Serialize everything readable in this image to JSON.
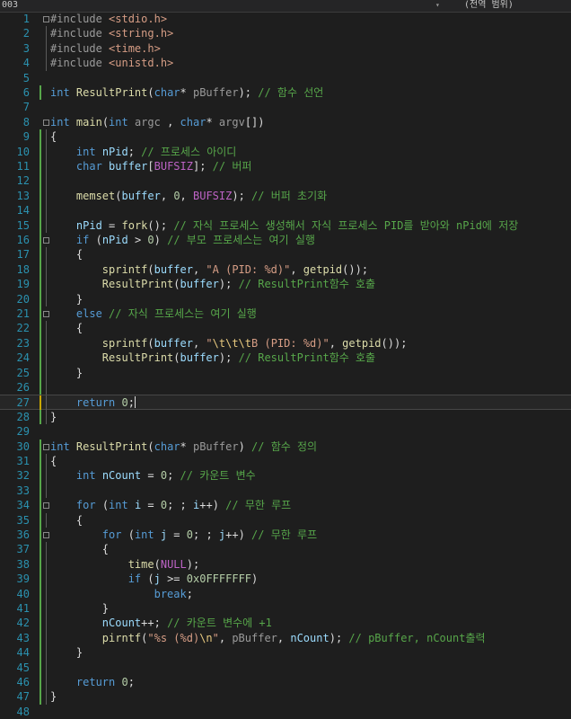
{
  "header": {
    "file_label": "003",
    "scope_label": "(전역 범위)"
  },
  "lines": [
    {
      "n": "1",
      "fold": "box",
      "guide": "",
      "tokens": [
        [
          "pp",
          "#include "
        ],
        [
          "st",
          "<stdio.h>"
        ]
      ]
    },
    {
      "n": "2",
      "fold": "v",
      "guide": "",
      "tokens": [
        [
          "pp",
          "#include "
        ],
        [
          "st",
          "<string.h>"
        ]
      ]
    },
    {
      "n": "3",
      "fold": "v",
      "guide": "",
      "tokens": [
        [
          "pp",
          "#include "
        ],
        [
          "st",
          "<time.h>"
        ]
      ]
    },
    {
      "n": "4",
      "fold": "v",
      "guide": "",
      "tokens": [
        [
          "pp",
          "#include "
        ],
        [
          "st",
          "<unistd.h>"
        ]
      ]
    },
    {
      "n": "5",
      "fold": "",
      "guide": "",
      "tokens": []
    },
    {
      "n": "6",
      "fold": "",
      "guide": "green",
      "tokens": [
        [
          "kw",
          "int "
        ],
        [
          "fn",
          "ResultPrint"
        ],
        [
          "",
          "("
        ],
        [
          "kw",
          "char"
        ],
        [
          "",
          "* "
        ],
        [
          "par",
          "pBuffer"
        ],
        [
          "",
          "); "
        ],
        [
          "cm",
          "// 함수 선언"
        ]
      ]
    },
    {
      "n": "7",
      "fold": "",
      "guide": "",
      "tokens": []
    },
    {
      "n": "8",
      "fold": "box",
      "guide": "",
      "tokens": [
        [
          "kw",
          "int "
        ],
        [
          "fn",
          "main"
        ],
        [
          "",
          "("
        ],
        [
          "kw",
          "int "
        ],
        [
          "par",
          "argc"
        ],
        [
          "",
          " , "
        ],
        [
          "kw",
          "char"
        ],
        [
          "",
          "* "
        ],
        [
          "par",
          "argv"
        ],
        [
          "",
          "[])"
        ]
      ]
    },
    {
      "n": "9",
      "fold": "v",
      "guide": "green",
      "tokens": [
        [
          "",
          "{"
        ]
      ]
    },
    {
      "n": "10",
      "fold": "v",
      "guide": "green",
      "tokens": [
        [
          "",
          "    "
        ],
        [
          "kw",
          "int "
        ],
        [
          "va",
          "nPid"
        ],
        [
          "",
          "; "
        ],
        [
          "cm",
          "// 프로세스 아이디"
        ]
      ]
    },
    {
      "n": "11",
      "fold": "v",
      "guide": "green",
      "tokens": [
        [
          "",
          "    "
        ],
        [
          "kw",
          "char "
        ],
        [
          "va",
          "buffer"
        ],
        [
          "",
          "["
        ],
        [
          "mac",
          "BUFSIZ"
        ],
        [
          "",
          "]; "
        ],
        [
          "cm",
          "// 버퍼"
        ]
      ]
    },
    {
      "n": "12",
      "fold": "v",
      "guide": "green",
      "tokens": []
    },
    {
      "n": "13",
      "fold": "v",
      "guide": "green",
      "tokens": [
        [
          "",
          "    "
        ],
        [
          "fn",
          "memset"
        ],
        [
          "",
          "("
        ],
        [
          "va",
          "buffer"
        ],
        [
          "",
          ", "
        ],
        [
          "nu",
          "0"
        ],
        [
          "",
          ", "
        ],
        [
          "mac",
          "BUFSIZ"
        ],
        [
          "",
          "); "
        ],
        [
          "cm",
          "// 버퍼 초기화"
        ]
      ]
    },
    {
      "n": "14",
      "fold": "v",
      "guide": "green",
      "tokens": []
    },
    {
      "n": "15",
      "fold": "v",
      "guide": "green",
      "tokens": [
        [
          "",
          "    "
        ],
        [
          "va",
          "nPid"
        ],
        [
          "",
          " = "
        ],
        [
          "fn",
          "fork"
        ],
        [
          "",
          "(); "
        ],
        [
          "cm",
          "// 자식 프로세스 생성해서 자식 프로세스 PID를 받아와 nPid에 저장"
        ]
      ]
    },
    {
      "n": "16",
      "fold": "box",
      "guide": "green",
      "tokens": [
        [
          "",
          "    "
        ],
        [
          "kw",
          "if "
        ],
        [
          "",
          "("
        ],
        [
          "va",
          "nPid"
        ],
        [
          "",
          " > "
        ],
        [
          "nu",
          "0"
        ],
        [
          "",
          ") "
        ],
        [
          "cm",
          "// 부모 프로세스는 여기 실행"
        ]
      ]
    },
    {
      "n": "17",
      "fold": "v",
      "guide": "green",
      "tokens": [
        [
          "",
          "    {"
        ]
      ]
    },
    {
      "n": "18",
      "fold": "v",
      "guide": "green",
      "tokens": [
        [
          "",
          "        "
        ],
        [
          "fn",
          "sprintf"
        ],
        [
          "",
          "("
        ],
        [
          "va",
          "buffer"
        ],
        [
          "",
          ", "
        ],
        [
          "st",
          "\"A (PID: %d)\""
        ],
        [
          "",
          ", "
        ],
        [
          "fn",
          "getpid"
        ],
        [
          "",
          "());"
        ]
      ]
    },
    {
      "n": "19",
      "fold": "v",
      "guide": "green",
      "tokens": [
        [
          "",
          "        "
        ],
        [
          "fn",
          "ResultPrint"
        ],
        [
          "",
          "("
        ],
        [
          "va",
          "buffer"
        ],
        [
          "",
          "); "
        ],
        [
          "cm",
          "// ResultPrint함수 호출"
        ]
      ]
    },
    {
      "n": "20",
      "fold": "v",
      "guide": "green",
      "tokens": [
        [
          "",
          "    }"
        ]
      ]
    },
    {
      "n": "21",
      "fold": "box",
      "guide": "green",
      "tokens": [
        [
          "",
          "    "
        ],
        [
          "kw",
          "else "
        ],
        [
          "cm",
          "// 자식 프로세스는 여기 실행"
        ]
      ]
    },
    {
      "n": "22",
      "fold": "v",
      "guide": "green",
      "tokens": [
        [
          "",
          "    {"
        ]
      ]
    },
    {
      "n": "23",
      "fold": "v",
      "guide": "green",
      "tokens": [
        [
          "",
          "        "
        ],
        [
          "fn",
          "sprintf"
        ],
        [
          "",
          "("
        ],
        [
          "va",
          "buffer"
        ],
        [
          "",
          ", "
        ],
        [
          "st",
          "\""
        ],
        [
          "esc",
          "\\t\\t\\t"
        ],
        [
          "st",
          "B (PID: %d)\""
        ],
        [
          "",
          ", "
        ],
        [
          "fn",
          "getpid"
        ],
        [
          "",
          "());"
        ]
      ]
    },
    {
      "n": "24",
      "fold": "v",
      "guide": "green",
      "tokens": [
        [
          "",
          "        "
        ],
        [
          "fn",
          "ResultPrint"
        ],
        [
          "",
          "("
        ],
        [
          "va",
          "buffer"
        ],
        [
          "",
          "); "
        ],
        [
          "cm",
          "// ResultPrint함수 호출"
        ]
      ]
    },
    {
      "n": "25",
      "fold": "v",
      "guide": "green",
      "tokens": [
        [
          "",
          "    }"
        ]
      ]
    },
    {
      "n": "26",
      "fold": "v",
      "guide": "green",
      "tokens": []
    },
    {
      "n": "27",
      "fold": "v",
      "guide": "yellow",
      "cursor": true,
      "tokens": [
        [
          "",
          "    "
        ],
        [
          "kw",
          "return "
        ],
        [
          "nu",
          "0"
        ],
        [
          "",
          ";"
        ]
      ]
    },
    {
      "n": "28",
      "fold": "v",
      "guide": "green",
      "tokens": [
        [
          "",
          "}"
        ]
      ]
    },
    {
      "n": "29",
      "fold": "",
      "guide": "",
      "tokens": []
    },
    {
      "n": "30",
      "fold": "box",
      "guide": "green",
      "tokens": [
        [
          "kw",
          "int "
        ],
        [
          "fn",
          "ResultPrint"
        ],
        [
          "",
          "("
        ],
        [
          "kw",
          "char"
        ],
        [
          "",
          "* "
        ],
        [
          "par",
          "pBuffer"
        ],
        [
          "",
          ") "
        ],
        [
          "cm",
          "// 함수 정의"
        ]
      ]
    },
    {
      "n": "31",
      "fold": "v",
      "guide": "green",
      "tokens": [
        [
          "",
          "{"
        ]
      ]
    },
    {
      "n": "32",
      "fold": "v",
      "guide": "green",
      "tokens": [
        [
          "",
          "    "
        ],
        [
          "kw",
          "int "
        ],
        [
          "va",
          "nCount"
        ],
        [
          "",
          " = "
        ],
        [
          "nu",
          "0"
        ],
        [
          "",
          "; "
        ],
        [
          "cm",
          "// 카운트 변수"
        ]
      ]
    },
    {
      "n": "33",
      "fold": "v",
      "guide": "green",
      "tokens": []
    },
    {
      "n": "34",
      "fold": "box",
      "guide": "green",
      "tokens": [
        [
          "",
          "    "
        ],
        [
          "kw",
          "for "
        ],
        [
          "",
          "("
        ],
        [
          "kw",
          "int "
        ],
        [
          "va",
          "i"
        ],
        [
          "",
          " = "
        ],
        [
          "nu",
          "0"
        ],
        [
          "",
          "; ; "
        ],
        [
          "va",
          "i"
        ],
        [
          "",
          "++) "
        ],
        [
          "cm",
          "// 무한 루프"
        ]
      ]
    },
    {
      "n": "35",
      "fold": "v",
      "guide": "green",
      "tokens": [
        [
          "",
          "    {"
        ]
      ]
    },
    {
      "n": "36",
      "fold": "box",
      "guide": "green",
      "tokens": [
        [
          "",
          "        "
        ],
        [
          "kw",
          "for "
        ],
        [
          "",
          "("
        ],
        [
          "kw",
          "int "
        ],
        [
          "va",
          "j"
        ],
        [
          "",
          " = "
        ],
        [
          "nu",
          "0"
        ],
        [
          "",
          "; ; "
        ],
        [
          "va",
          "j"
        ],
        [
          "",
          "++) "
        ],
        [
          "cm",
          "// 무한 루프"
        ]
      ]
    },
    {
      "n": "37",
      "fold": "v",
      "guide": "green",
      "tokens": [
        [
          "",
          "        {"
        ]
      ]
    },
    {
      "n": "38",
      "fold": "v",
      "guide": "green",
      "tokens": [
        [
          "",
          "            "
        ],
        [
          "fn",
          "time"
        ],
        [
          "",
          "("
        ],
        [
          "mac",
          "NULL"
        ],
        [
          "",
          ");"
        ]
      ]
    },
    {
      "n": "39",
      "fold": "v",
      "guide": "green",
      "tokens": [
        [
          "",
          "            "
        ],
        [
          "kw",
          "if "
        ],
        [
          "",
          "("
        ],
        [
          "va",
          "j"
        ],
        [
          "",
          " >= "
        ],
        [
          "nu",
          "0x0FFFFFFF"
        ],
        [
          "",
          ")"
        ]
      ]
    },
    {
      "n": "40",
      "fold": "v",
      "guide": "green",
      "tokens": [
        [
          "",
          "                "
        ],
        [
          "kw",
          "break"
        ],
        [
          "",
          ";"
        ]
      ]
    },
    {
      "n": "41",
      "fold": "v",
      "guide": "green",
      "tokens": [
        [
          "",
          "        }"
        ]
      ]
    },
    {
      "n": "42",
      "fold": "v",
      "guide": "green",
      "tokens": [
        [
          "",
          "        "
        ],
        [
          "va",
          "nCount"
        ],
        [
          "",
          "++; "
        ],
        [
          "cm",
          "// 카운트 변수에 +1"
        ]
      ]
    },
    {
      "n": "43",
      "fold": "v",
      "guide": "green",
      "tokens": [
        [
          "",
          "        "
        ],
        [
          "fn",
          "pirntf"
        ],
        [
          "",
          "("
        ],
        [
          "st",
          "\"%s (%d)"
        ],
        [
          "esc",
          "\\n"
        ],
        [
          "st",
          "\""
        ],
        [
          "",
          ", "
        ],
        [
          "par",
          "pBuffer"
        ],
        [
          "",
          ", "
        ],
        [
          "va",
          "nCount"
        ],
        [
          "",
          "); "
        ],
        [
          "cm",
          "// pBuffer, nCount출력"
        ]
      ]
    },
    {
      "n": "44",
      "fold": "v",
      "guide": "green",
      "tokens": [
        [
          "",
          "    }"
        ]
      ]
    },
    {
      "n": "45",
      "fold": "v",
      "guide": "green",
      "tokens": []
    },
    {
      "n": "46",
      "fold": "v",
      "guide": "green",
      "tokens": [
        [
          "",
          "    "
        ],
        [
          "kw",
          "return "
        ],
        [
          "nu",
          "0"
        ],
        [
          "",
          ";"
        ]
      ]
    },
    {
      "n": "47",
      "fold": "v",
      "guide": "green",
      "tokens": [
        [
          "",
          "}"
        ]
      ]
    },
    {
      "n": "48",
      "fold": "",
      "guide": "",
      "tokens": []
    }
  ]
}
